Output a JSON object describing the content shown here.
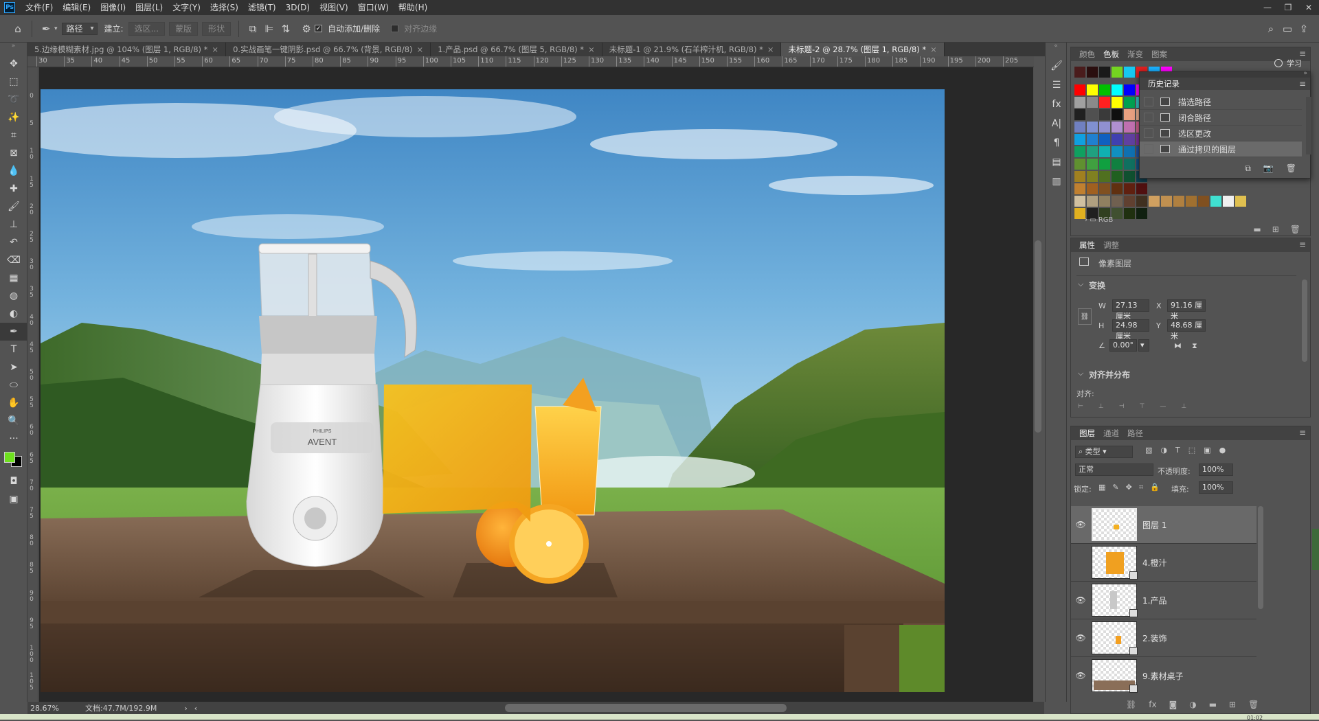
{
  "app": {
    "logo": "Ps"
  },
  "menu": [
    "文件(F)",
    "编辑(E)",
    "图像(I)",
    "图层(L)",
    "文字(Y)",
    "选择(S)",
    "滤镜(T)",
    "3D(D)",
    "视图(V)",
    "窗口(W)",
    "帮助(H)"
  ],
  "window_controls": [
    "—",
    "❐",
    "✕"
  ],
  "options": {
    "mode_select": "路径",
    "make_label": "建立:",
    "selection_btn": "选区...",
    "mask_btn": "蒙版",
    "shape_btn": "形状",
    "auto_add_label": "自动添加/删除",
    "align_edges_label": "对齐边缘",
    "auto_add_checked": "✓"
  },
  "tabs": [
    {
      "label": "5.边缘模糊素材.jpg @ 104% (图层 1, RGB/8) *",
      "close": "×"
    },
    {
      "label": "0.实战画笔一键阴影.psd @ 66.7% (背景, RGB/8)",
      "close": "×"
    },
    {
      "label": "1.产品.psd @ 66.7% (图层 5, RGB/8) *",
      "close": "×"
    },
    {
      "label": "未标题-1 @ 21.9% (石羊榨汁机, RGB/8) *",
      "close": "×"
    },
    {
      "label": "未标题-2 @ 28.7% (图层 1, RGB/8) *",
      "close": "×"
    }
  ],
  "ruler_h": [
    "30",
    "35",
    "40",
    "45",
    "50",
    "55",
    "60",
    "65",
    "70",
    "75",
    "80",
    "85",
    "90",
    "95",
    "100",
    "105",
    "110",
    "115",
    "120",
    "125",
    "130",
    "135",
    "140",
    "145",
    "150",
    "155",
    "160",
    "165",
    "170",
    "175",
    "180",
    "185",
    "190",
    "195",
    "200",
    "205"
  ],
  "ruler_v": [
    "0",
    "5",
    "10",
    "15",
    "20",
    "25",
    "30",
    "35",
    "40",
    "45",
    "50",
    "55",
    "60",
    "65",
    "70",
    "75",
    "80",
    "85",
    "90",
    "95",
    "100",
    "105"
  ],
  "status": {
    "zoom": "28.67%",
    "doc": "文档:47.7M/192.9M",
    "arrow": "›",
    "arrow_left": "‹"
  },
  "learn": {
    "label": "学习"
  },
  "swatches_panel": {
    "tabs": [
      "颜色",
      "色板",
      "渐变",
      "图案"
    ],
    "active": 1,
    "group_label": "RGB",
    "colors_row1": [
      "#4a1c1c",
      "#2a0e0e",
      "#1a1a1a",
      "#74d420",
      "#16c8f0",
      "#e02020",
      "#1ab0ff",
      "#ff00ff"
    ],
    "grid": [
      [
        "#ff0000",
        "#ffff00",
        "#00c000",
        "#00ffff",
        "#0000ff",
        "#ff00ff"
      ],
      [
        "#a0a0a0",
        "#8a8a8a",
        "#ff2020",
        "#ffff00",
        "#00a050",
        "#30c0c0"
      ],
      [
        "#202020",
        "#505050",
        "#3a3a3a",
        "#101010",
        "#e8a080",
        "#f0b090"
      ],
      [
        "#7080c0",
        "#8090d0",
        "#9090d0",
        "#b090d0",
        "#c070b0",
        "#d06090"
      ],
      [
        "#10a0e0",
        "#2080d0",
        "#1060c0",
        "#4040b0",
        "#6040a0",
        "#8030a0"
      ],
      [
        "#10a060",
        "#20a080",
        "#10b0b0",
        "#1090c0",
        "#1070b0",
        "#2050a0"
      ],
      [
        "#609030",
        "#40a040",
        "#10a040",
        "#108040",
        "#107060",
        "#105080"
      ],
      [
        "#a08020",
        "#808020",
        "#507020",
        "#206020",
        "#105030",
        "#104050"
      ],
      [
        "#c08030",
        "#a06020",
        "#805020",
        "#603010",
        "#602010",
        "#501010"
      ],
      [
        "#d0c0a0",
        "#b0a080",
        "#908060",
        "#706050",
        "#604030",
        "#403020"
      ],
      [
        "#e0b020",
        "#202020",
        "#304020",
        "#405030",
        "#203010",
        "#102010"
      ]
    ],
    "grid_extra": [
      "#d0a060",
      "#c09050",
      "#b08040",
      "#a07030",
      "#805020",
      "#40e0d0",
      "#f0f0f0",
      "#e0c050"
    ]
  },
  "history": {
    "title": "历史记录",
    "items": [
      "描选路径",
      "闭合路径",
      "选区更改",
      "通过拷贝的图层"
    ],
    "active": 3
  },
  "properties": {
    "tabs": [
      "属性",
      "调整"
    ],
    "type_label": "像素图层",
    "transform_title": "变换",
    "w_label": "W",
    "w": "27.13 厘米",
    "h_label": "H",
    "h": "24.98 厘米",
    "x_label": "X",
    "x": "91.16 厘米",
    "y_label": "Y",
    "y": "48.68 厘米",
    "angle": "0.00°",
    "align_title": "对齐并分布",
    "align_label": "对齐:"
  },
  "layers": {
    "tabs": [
      "图层",
      "通道",
      "路径"
    ],
    "filter_label": "类型",
    "blend_mode": "正常",
    "opacity_label": "不透明度:",
    "opacity": "100%",
    "lock_label": "锁定:",
    "fill_label": "填充:",
    "fill": "100%",
    "items": [
      {
        "name": "图层 1",
        "visible": "👁",
        "active": true
      },
      {
        "name": "4.橙汁",
        "visible": "",
        "active": false
      },
      {
        "name": "1.产品",
        "visible": "👁",
        "active": false
      },
      {
        "name": "2.装饰",
        "visible": "👁",
        "active": false
      },
      {
        "name": "9.素材桌子",
        "visible": "👁",
        "active": false
      }
    ]
  },
  "product": {
    "brand1": "PHILIPS",
    "brand2": "AVENT"
  },
  "colors": {
    "foreground": "#6ee01e",
    "background": "#000000",
    "accent": "#31a8ff"
  },
  "clock": "01:02"
}
